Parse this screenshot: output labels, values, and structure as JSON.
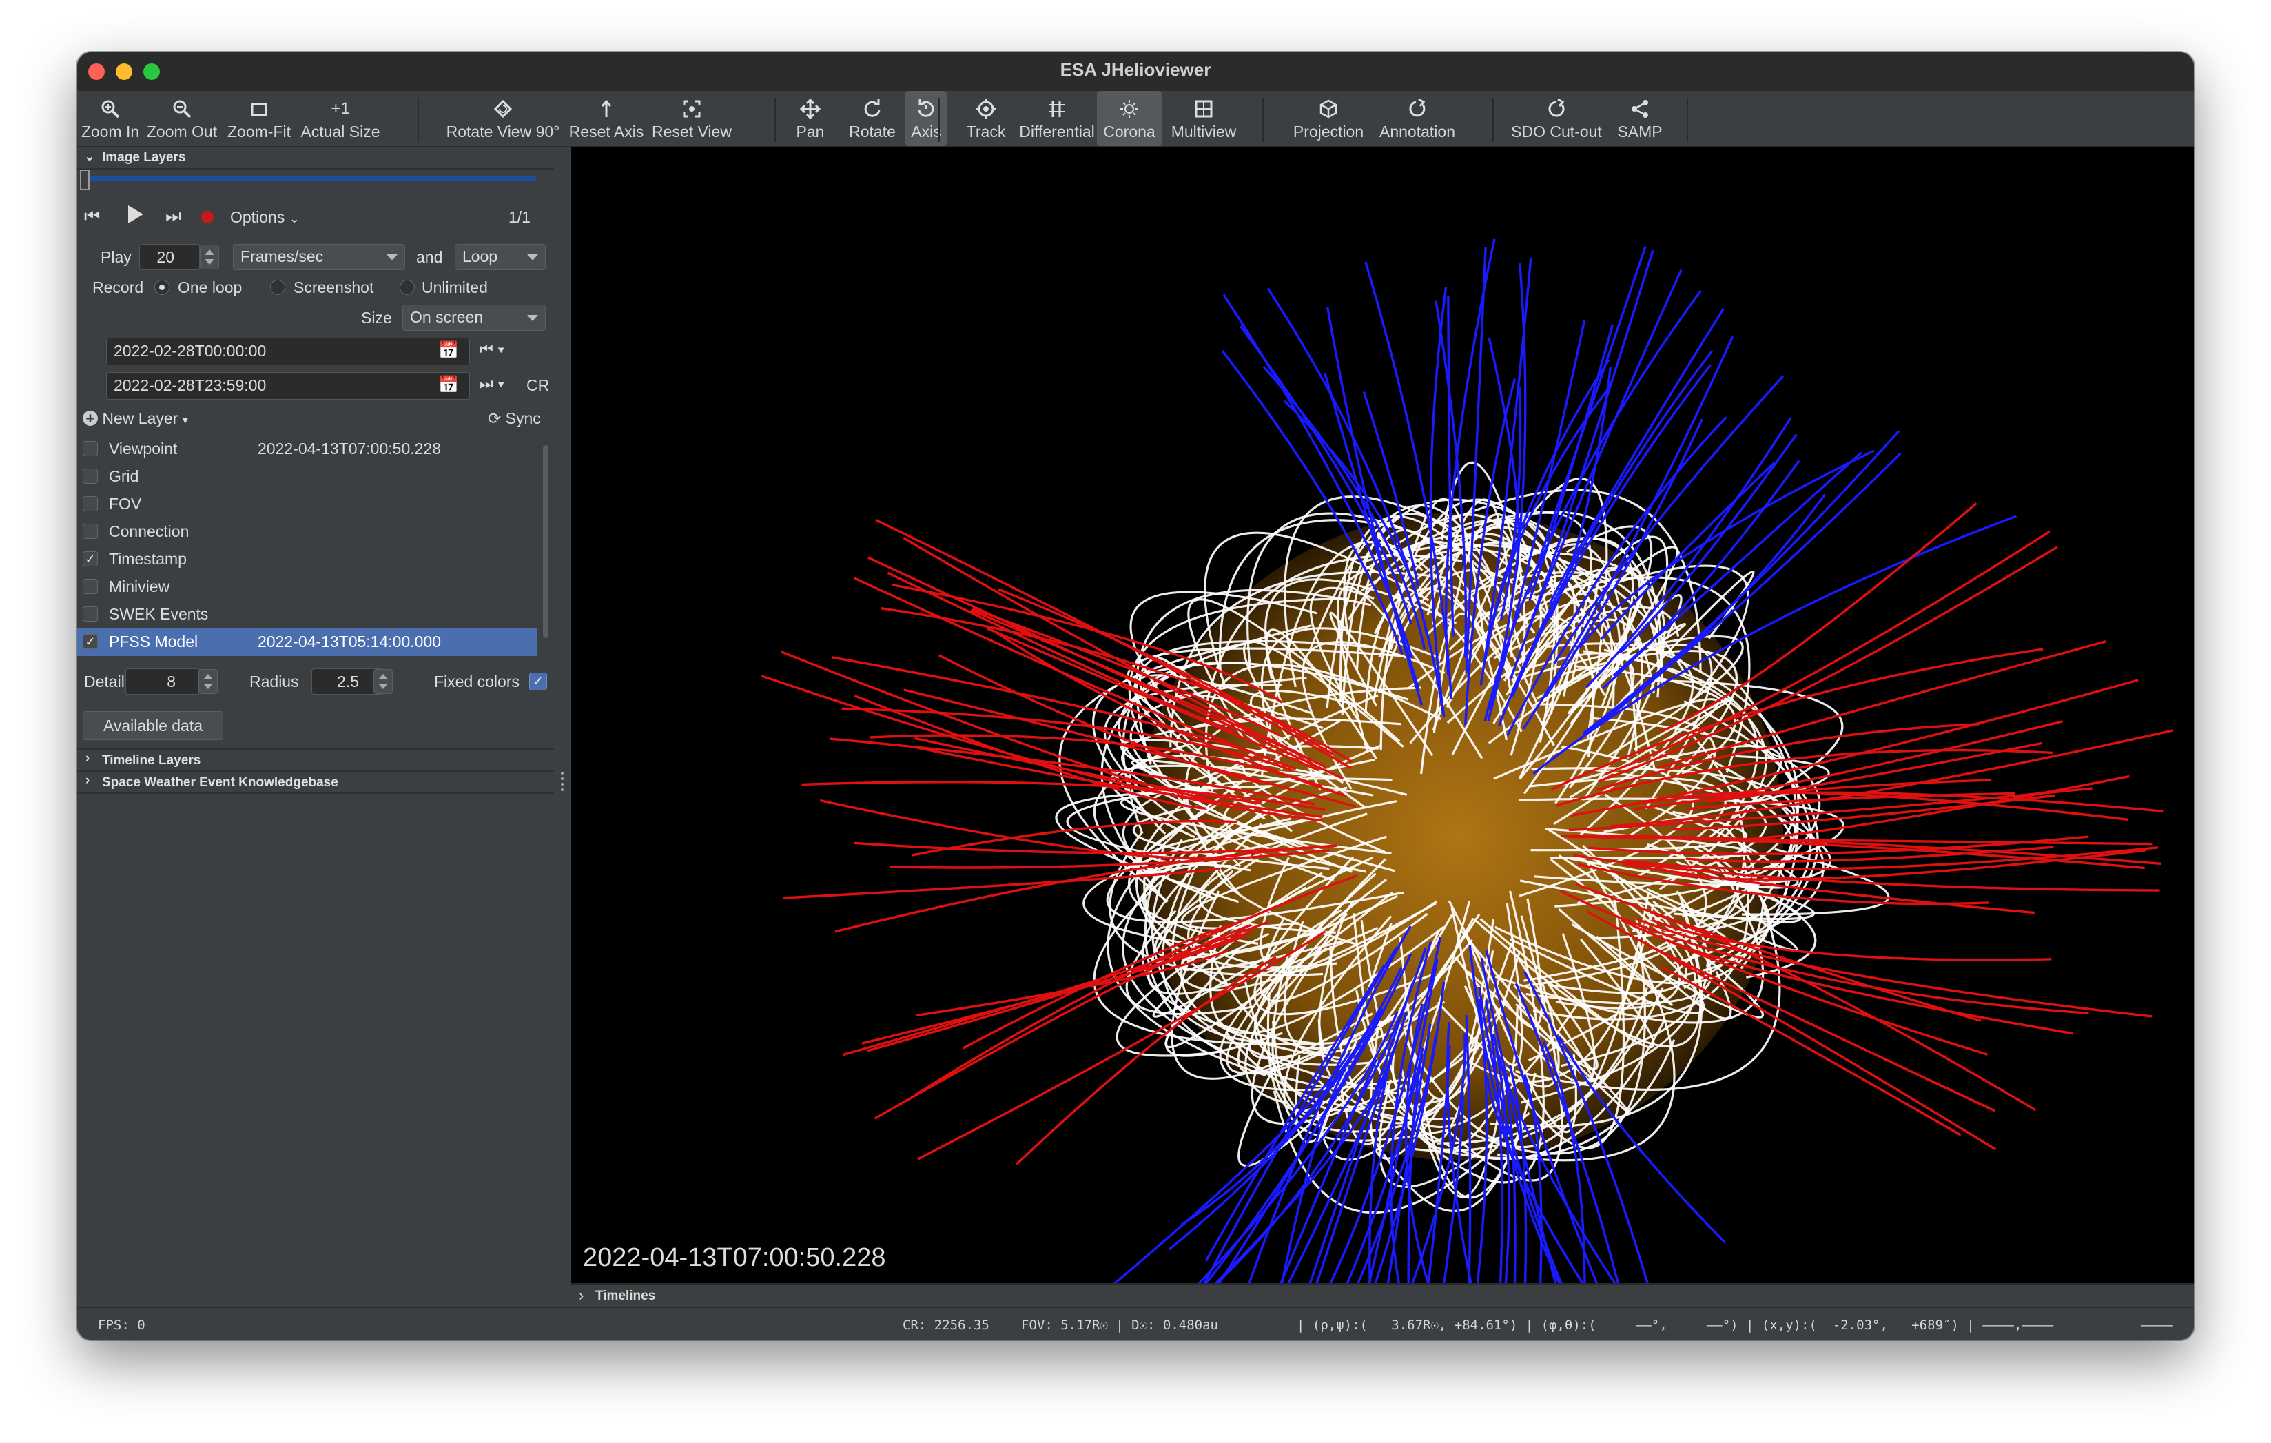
{
  "window": {
    "title": "ESA JHelioviewer"
  },
  "toolbar": {
    "zoom_in": "Zoom In",
    "zoom_out": "Zoom Out",
    "zoom_fit": "Zoom-Fit",
    "actual_size": "Actual Size",
    "actual_size_glyph": "+1",
    "rotate_view": "Rotate View 90°",
    "reset_axis": "Reset Axis",
    "reset_view": "Reset View",
    "pan": "Pan",
    "rotate": "Rotate",
    "axis": "Axis",
    "track": "Track",
    "differential": "Differential",
    "corona": "Corona",
    "multiview": "Multiview",
    "projection": "Projection",
    "annotation": "Annotation",
    "sdo_cutout": "SDO Cut-out",
    "samp": "SAMP"
  },
  "image_layers": {
    "header": "Image Layers",
    "options_label": "Options",
    "frame_counter": "1/1",
    "play_label": "Play",
    "fps_value": "20",
    "fps_unit": "Frames/sec",
    "and_label": "and",
    "loop_mode": "Loop",
    "record_label": "Record",
    "record_options": [
      "One loop",
      "Screenshot",
      "Unlimited"
    ],
    "size_label": "Size",
    "size_value": "On screen",
    "start_time": "2022-02-28T00:00:00",
    "end_time": "2022-02-28T23:59:00",
    "cr_label": "CR",
    "new_layer": "New Layer",
    "sync_label": "Sync",
    "layers": [
      {
        "name": "Viewpoint",
        "value": "2022-04-13T07:00:50.228",
        "checked": false
      },
      {
        "name": "Grid",
        "value": "",
        "checked": false
      },
      {
        "name": "FOV",
        "value": "",
        "checked": false
      },
      {
        "name": "Connection",
        "value": "",
        "checked": false
      },
      {
        "name": "Timestamp",
        "value": "",
        "checked": true
      },
      {
        "name": "Miniview",
        "value": "",
        "checked": false
      },
      {
        "name": "SWEK Events",
        "value": "",
        "checked": false
      },
      {
        "name": "PFSS Model",
        "value": "2022-04-13T05:14:00.000",
        "checked": true
      }
    ],
    "check_glyph": "✓",
    "detail_label": "Detail",
    "detail_value": "8",
    "radius_label": "Radius",
    "radius_value": "2.5",
    "fixed_colors_label": "Fixed colors",
    "available_data": "Available data"
  },
  "timeline_layers": {
    "header": "Timeline Layers"
  },
  "swek": {
    "header": "Space Weather Event Knowledgebase"
  },
  "viewer": {
    "timestamp": "2022-04-13T07:00:50.228"
  },
  "timelines": {
    "header": "Timelines"
  },
  "status": {
    "fps": "FPS:  0",
    "cr": "CR: 2256.35",
    "fov": "FOV:   5.17R☉ | D☉:   0.480au",
    "polar": "| (ρ,ψ):(   3.67R☉, +84.61°) | (φ,θ):(     ––°,     ––°) | (x,y):(  -2.03°,   +689″) | ––––,––––",
    "tail": "––––"
  },
  "colors": {
    "accent": "#4b6eaf",
    "field_open_neg": "#1a1aff",
    "field_open_pos": "#e01010",
    "field_closed": "#ffffff",
    "sun": "#c8860a"
  }
}
